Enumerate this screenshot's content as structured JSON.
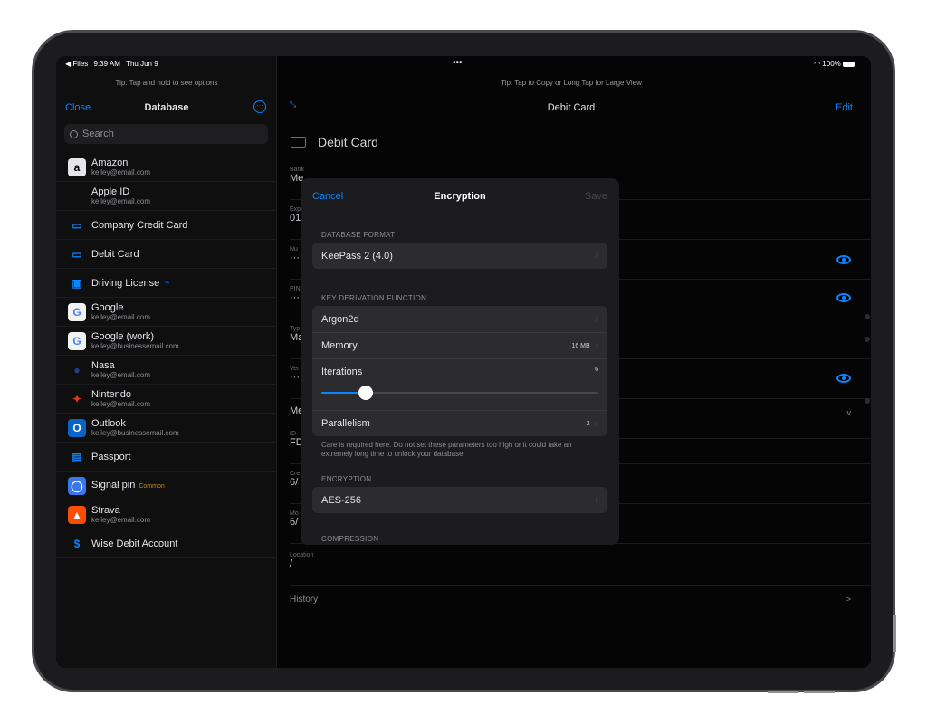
{
  "status": {
    "back_app": "◀ Files",
    "time": "9:39 AM",
    "date": "Thu Jun 9",
    "dots": "•••",
    "battery": "100%"
  },
  "sidebar": {
    "tip": "Tip: Tap and hold to see options",
    "close": "Close",
    "title": "Database",
    "search_placeholder": "Search",
    "items": [
      {
        "title": "Amazon",
        "subtitle": "kelley@email.com",
        "icon": "amazon-icon",
        "glyph": "a",
        "color": "#e5e5ea",
        "fg": "#000"
      },
      {
        "title": "Apple ID",
        "subtitle": "kelley@email.com",
        "icon": "apple-icon",
        "glyph": "",
        "color": "transparent",
        "fg": "#d1d1d6"
      },
      {
        "title": "Company Credit Card",
        "subtitle": "",
        "icon": "credit-card-icon",
        "glyph": "▭",
        "color": "transparent",
        "fg": "#0a84ff"
      },
      {
        "title": "Debit Card",
        "subtitle": "",
        "icon": "credit-card-icon",
        "glyph": "▭",
        "color": "transparent",
        "fg": "#0a84ff"
      },
      {
        "title": "Driving License",
        "subtitle": "",
        "icon": "id-card-icon",
        "glyph": "▣",
        "color": "transparent",
        "fg": "#0a84ff",
        "attach": "🖇"
      },
      {
        "title": "Google",
        "subtitle": "kelley@email.com",
        "icon": "google-icon",
        "glyph": "G",
        "color": "#f2f2f2",
        "fg": "#4285f4"
      },
      {
        "title": "Google (work)",
        "subtitle": "kelley@businessemail.com",
        "icon": "google-icon",
        "glyph": "G",
        "color": "#f2f2f2",
        "fg": "#4285f4"
      },
      {
        "title": "Nasa",
        "subtitle": "kelley@email.com",
        "icon": "nasa-icon",
        "glyph": "●",
        "color": "transparent",
        "fg": "#1c3f94"
      },
      {
        "title": "Nintendo",
        "subtitle": "kelley@email.com",
        "icon": "mario-icon",
        "glyph": "✦",
        "color": "transparent",
        "fg": "#e03a1e"
      },
      {
        "title": "Outlook",
        "subtitle": "kelley@businessemail.com",
        "icon": "outlook-icon",
        "glyph": "O",
        "color": "#0a64c8",
        "fg": "#fff"
      },
      {
        "title": "Passport",
        "subtitle": "",
        "icon": "document-icon",
        "glyph": "▤",
        "color": "transparent",
        "fg": "#0a84ff"
      },
      {
        "title": "Signal pin",
        "subtitle": "",
        "icon": "signal-icon",
        "glyph": "◯",
        "color": "#3a76f0",
        "fg": "#fff",
        "badge": "Common"
      },
      {
        "title": "Strava",
        "subtitle": "kelley@email.com",
        "icon": "strava-icon",
        "glyph": "▲",
        "color": "#fc4c02",
        "fg": "#fff"
      },
      {
        "title": "Wise Debit Account",
        "subtitle": "",
        "icon": "dollar-icon",
        "glyph": "$",
        "color": "transparent",
        "fg": "#0a84ff"
      }
    ]
  },
  "detail": {
    "tip": "Tip: Tap to Copy or Long Tap for Large View",
    "title": "Debit Card",
    "edit": "Edit",
    "entry_title": "Debit Card",
    "fields": [
      {
        "label": "Bank",
        "value": "Me"
      },
      {
        "label": "Exp",
        "value": "01"
      },
      {
        "label": "Nu",
        "value": "···"
      },
      {
        "label": "PIN",
        "value": "···"
      },
      {
        "label": "Typ",
        "value": "Ma"
      },
      {
        "label": "Ver",
        "value": "···"
      },
      {
        "label": "",
        "value": "Me"
      },
      {
        "label": "ID",
        "value": "FD"
      },
      {
        "label": "Cre",
        "value": "6/"
      },
      {
        "label": "Mo",
        "value": "6/"
      },
      {
        "label": "Location",
        "value": "/"
      }
    ],
    "history": "History",
    "history_chevron": ">",
    "expand_chevron": "v"
  },
  "modal": {
    "cancel": "Cancel",
    "title": "Encryption",
    "save": "Save",
    "sec_format": "DATABASE FORMAT",
    "format_value": "KeePass 2 (4.0)",
    "sec_kdf": "KEY DERIVATION FUNCTION",
    "kdf_value": "Argon2d",
    "memory_label": "Memory",
    "memory_value": "16 MB",
    "iterations_label": "Iterations",
    "iterations_value": "6",
    "iterations_fraction": 0.16,
    "parallelism_label": "Parallelism",
    "parallelism_value": "2",
    "note": "Care is required here. Do not set these parameters too high or it could take an extremely long time to unlock your database.",
    "sec_encryption": "ENCRYPTION",
    "encryption_value": "AES-256",
    "sec_compression": "COMPRESSION"
  }
}
